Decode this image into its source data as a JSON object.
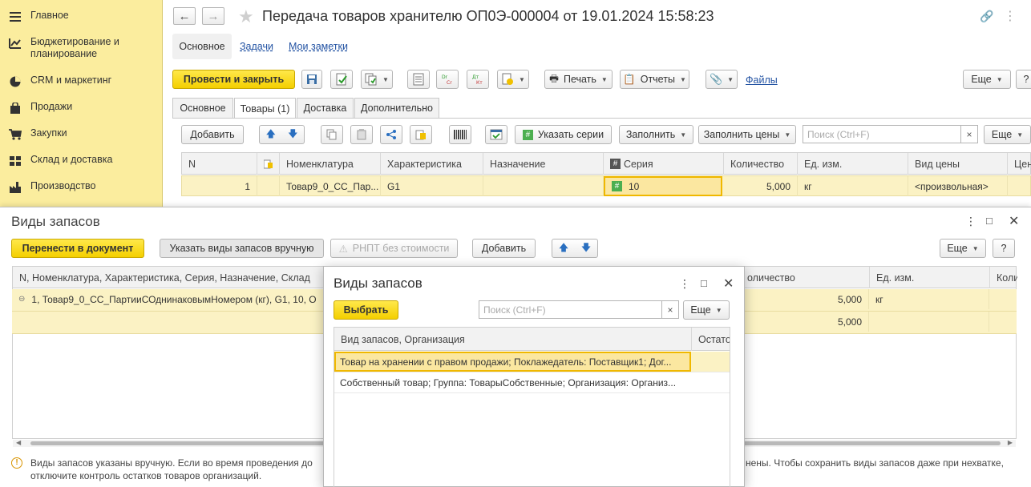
{
  "sidebar": {
    "items": [
      {
        "label": "Главное",
        "icon": "menu-icon"
      },
      {
        "label": "Бюджетирование и планирование",
        "icon": "chart-icon"
      },
      {
        "label": "CRM и маркетинг",
        "icon": "pie-icon"
      },
      {
        "label": "Продажи",
        "icon": "bag-icon"
      },
      {
        "label": "Закупки",
        "icon": "cart-icon"
      },
      {
        "label": "Склад и доставка",
        "icon": "warehouse-icon"
      },
      {
        "label": "Производство",
        "icon": "factory-icon"
      }
    ]
  },
  "document": {
    "title": "Передача товаров хранителю ОП0Э-000004 от 19.01.2024 15:58:23",
    "subtabs": {
      "main": "Основное",
      "tasks": "Задачи",
      "notes": "Мои заметки"
    },
    "toolbar": {
      "post_close": "Провести и закрыть",
      "print": "Печать",
      "reports": "Отчеты",
      "files": "Файлы",
      "more": "Еще",
      "help": "?"
    },
    "tabs": [
      "Основное",
      "Товары (1)",
      "Доставка",
      "Дополнительно"
    ],
    "goods_toolbar": {
      "add": "Добавить",
      "series": "Указать серии",
      "fill": "Заполнить",
      "fill_prices": "Заполнить цены",
      "search_placeholder": "Поиск (Ctrl+F)",
      "clear": "×",
      "more": "Еще"
    },
    "grid": {
      "columns": [
        "N",
        "",
        "Номенклатура",
        "Характеристика",
        "Назначение",
        "Серия",
        "Количество",
        "Ед. изм.",
        "Вид цены",
        "Цен"
      ],
      "row": {
        "n": "1",
        "item": "Товар9_0_СС_Пар...",
        "char": "G1",
        "purpose": "",
        "series": "10",
        "qty": "5,000",
        "unit": "кг",
        "price_type": "<произвольная>"
      }
    }
  },
  "dialog1": {
    "title": "Виды запасов",
    "buttons": {
      "transfer": "Перенести в документ",
      "manual": "Указать виды запасов вручную",
      "rnpt": "РНПТ без стоимости",
      "add": "Добавить",
      "more": "Еще",
      "help": "?"
    },
    "columns": {
      "main": "N, Номенклатура, Характеристика, Серия, Назначение, Склад",
      "qty": "оличество",
      "unit": "Ед. изм.",
      "extra": "Коли"
    },
    "rows": [
      {
        "text": "1, Товар9_0_СС_ПартииСОднинаковымНомером (кг), G1, 10, О",
        "qty": "5,000",
        "unit": "кг"
      },
      {
        "text": "",
        "qty": "5,000",
        "unit": ""
      }
    ],
    "warning_line1": "Виды запасов указаны вручную. Если во время проведения до",
    "warning_tail": "нены. Чтобы сохранить виды запасов даже при нехватке,",
    "warning_line2": "отключите контроль остатков товаров организаций."
  },
  "dialog2": {
    "title": "Виды запасов",
    "select": "Выбрать",
    "search_placeholder": "Поиск (Ctrl+F)",
    "clear": "×",
    "more": "Еще",
    "columns": {
      "main": "Вид запасов, Организация",
      "rest": "Остато"
    },
    "rows": [
      "Товар на хранении с правом продажи; Поклажедатель: Поставщик1; Дог...",
      "Собственный товар; Группа: ТоварыСобственные; Организация: Организ..."
    ]
  }
}
